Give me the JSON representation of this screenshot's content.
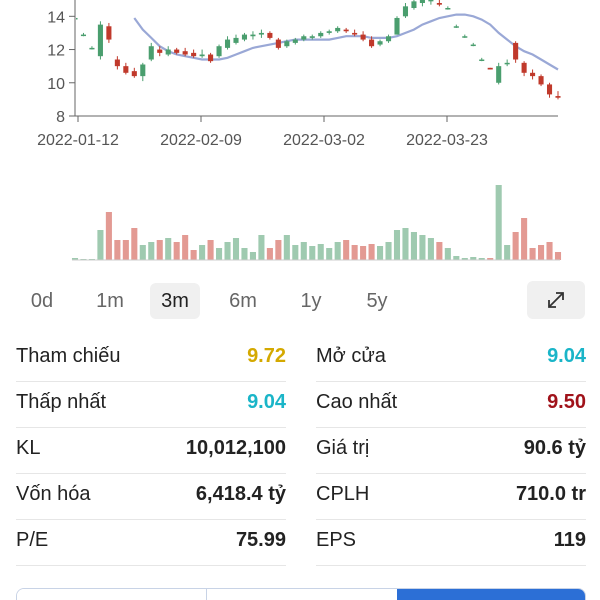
{
  "chart_data": {
    "type": "candlestick",
    "y_ticks": [
      "8",
      "10",
      "12",
      "14"
    ],
    "ylim": [
      8,
      14.5
    ],
    "x_ticks": [
      "2022-01-12",
      "2022-02-09",
      "2022-03-02",
      "2022-03-23"
    ],
    "colors": {
      "up": "#4a9e6e",
      "down": "#c0392b",
      "ma": "#9aa8d6",
      "vol_up": "#9fcab0",
      "vol_down": "#e39a93"
    },
    "candles": [
      [
        13.9,
        14.0,
        13.8,
        13.9
      ],
      [
        12.9,
        13.0,
        12.8,
        12.9
      ],
      [
        12.1,
        12.2,
        12.0,
        12.1
      ],
      [
        11.6,
        13.7,
        11.4,
        13.5
      ],
      [
        13.4,
        13.6,
        12.4,
        12.6
      ],
      [
        11.4,
        11.6,
        10.8,
        11.0
      ],
      [
        11.0,
        11.2,
        10.5,
        10.6
      ],
      [
        10.7,
        10.9,
        10.3,
        10.4
      ],
      [
        10.4,
        11.2,
        10.1,
        11.1
      ],
      [
        11.4,
        12.4,
        11.3,
        12.2
      ],
      [
        12.0,
        12.2,
        11.6,
        11.8
      ],
      [
        11.7,
        12.2,
        11.6,
        12.0
      ],
      [
        12.0,
        12.1,
        11.7,
        11.8
      ],
      [
        11.9,
        12.1,
        11.6,
        11.7
      ],
      [
        11.8,
        12.0,
        11.5,
        11.6
      ],
      [
        11.6,
        12.0,
        11.5,
        11.7
      ],
      [
        11.7,
        11.8,
        11.2,
        11.3
      ],
      [
        11.6,
        12.3,
        11.5,
        12.2
      ],
      [
        12.1,
        12.8,
        12.0,
        12.6
      ],
      [
        12.4,
        12.9,
        12.3,
        12.7
      ],
      [
        12.6,
        13.0,
        12.5,
        12.9
      ],
      [
        12.8,
        13.1,
        12.6,
        12.9
      ],
      [
        12.9,
        13.2,
        12.7,
        13.0
      ],
      [
        13.0,
        13.1,
        12.6,
        12.7
      ],
      [
        12.6,
        12.7,
        12.0,
        12.1
      ],
      [
        12.2,
        12.6,
        12.1,
        12.5
      ],
      [
        12.4,
        12.7,
        12.3,
        12.6
      ],
      [
        12.6,
        12.9,
        12.5,
        12.8
      ],
      [
        12.7,
        12.9,
        12.6,
        12.8
      ],
      [
        12.8,
        13.1,
        12.7,
        13.0
      ],
      [
        13.0,
        13.2,
        12.9,
        13.1
      ],
      [
        13.1,
        13.4,
        13.0,
        13.3
      ],
      [
        13.2,
        13.3,
        13.0,
        13.1
      ],
      [
        13.0,
        13.2,
        12.8,
        12.9
      ],
      [
        12.9,
        13.1,
        12.5,
        12.6
      ],
      [
        12.6,
        12.8,
        12.1,
        12.2
      ],
      [
        12.3,
        12.6,
        12.2,
        12.5
      ],
      [
        12.5,
        12.9,
        12.4,
        12.8
      ],
      [
        12.9,
        14.0,
        12.9,
        13.9
      ],
      [
        14.0,
        14.8,
        13.9,
        14.6
      ],
      [
        14.5,
        15.0,
        14.4,
        14.9
      ],
      [
        14.8,
        15.1,
        14.6,
        15.0
      ],
      [
        14.9,
        15.2,
        14.7,
        15.1
      ],
      [
        14.8,
        15.0,
        14.6,
        14.7
      ],
      [
        14.5,
        14.6,
        14.4,
        14.5
      ],
      [
        13.4,
        13.5,
        13.3,
        13.4
      ],
      [
        12.8,
        12.9,
        12.7,
        12.8
      ],
      [
        12.3,
        12.4,
        12.2,
        12.3
      ],
      [
        11.4,
        11.5,
        11.3,
        11.4
      ],
      [
        10.9,
        10.9,
        10.8,
        10.8
      ],
      [
        10.0,
        11.2,
        9.9,
        11.0
      ],
      [
        11.2,
        11.4,
        11.0,
        11.2
      ],
      [
        12.4,
        12.5,
        11.2,
        11.4
      ],
      [
        11.2,
        11.3,
        10.4,
        10.6
      ],
      [
        10.6,
        10.8,
        10.2,
        10.4
      ],
      [
        10.4,
        10.5,
        9.8,
        9.9
      ],
      [
        9.9,
        10.0,
        9.1,
        9.3
      ],
      [
        9.2,
        9.5,
        9.0,
        9.1
      ]
    ],
    "volume": [
      2,
      1,
      1,
      30,
      48,
      20,
      20,
      32,
      15,
      18,
      20,
      22,
      18,
      25,
      10,
      15,
      20,
      12,
      18,
      22,
      12,
      8,
      25,
      12,
      20,
      25,
      15,
      18,
      14,
      16,
      12,
      18,
      20,
      15,
      14,
      16,
      14,
      18,
      30,
      32,
      28,
      25,
      22,
      18,
      12,
      4,
      2,
      3,
      2,
      2,
      75,
      15,
      28,
      42,
      12,
      15,
      18,
      8
    ],
    "ma": [
      null,
      null,
      null,
      null,
      null,
      null,
      null,
      13.9,
      13.2,
      12.7,
      12.2,
      11.9,
      11.7,
      11.6,
      11.5,
      11.4,
      11.4,
      11.4,
      11.5,
      11.7,
      11.9,
      12.1,
      12.2,
      12.3,
      12.4,
      12.5,
      12.6,
      12.6,
      12.6,
      12.6,
      12.6,
      12.7,
      12.8,
      12.8,
      12.8,
      12.7,
      12.7,
      12.7,
      12.8,
      13.0,
      13.2,
      13.5,
      13.7,
      13.9,
      14.0,
      14.1,
      14.1,
      14.0,
      13.8,
      13.5,
      13.0,
      12.6,
      12.2,
      11.9,
      11.7,
      11.4,
      11.1,
      10.8
    ]
  },
  "tabs": [
    "0d",
    "1m",
    "3m",
    "6m",
    "1y",
    "5y"
  ],
  "active_tab": "3m",
  "icons": {
    "expand": "expand-arrows-icon"
  },
  "stats": [
    {
      "left": {
        "label": "Tham chiếu",
        "value": "9.72",
        "color": "#d4a900"
      },
      "right": {
        "label": "Mở cửa",
        "value": "9.04",
        "color": "#1ab5c8"
      }
    },
    {
      "left": {
        "label": "Thấp nhất",
        "value": "9.04",
        "color": "#1ab5c8"
      },
      "right": {
        "label": "Cao nhất",
        "value": "9.50",
        "color": "#a0121a"
      }
    },
    {
      "left": {
        "label": "KL",
        "value": "10,012,100",
        "color": "#222222"
      },
      "right": {
        "label": "Giá trị",
        "value": "90.6 tỷ",
        "color": "#222222"
      }
    },
    {
      "left": {
        "label": "Vốn hóa",
        "value": "6,418.4 tỷ",
        "color": "#222222"
      },
      "right": {
        "label": "CPLH",
        "value": "710.0 tr",
        "color": "#222222"
      }
    },
    {
      "left": {
        "label": "P/E",
        "value": "75.99",
        "color": "#222222"
      },
      "right": {
        "label": "EPS",
        "value": "119",
        "color": "#222222"
      }
    }
  ]
}
